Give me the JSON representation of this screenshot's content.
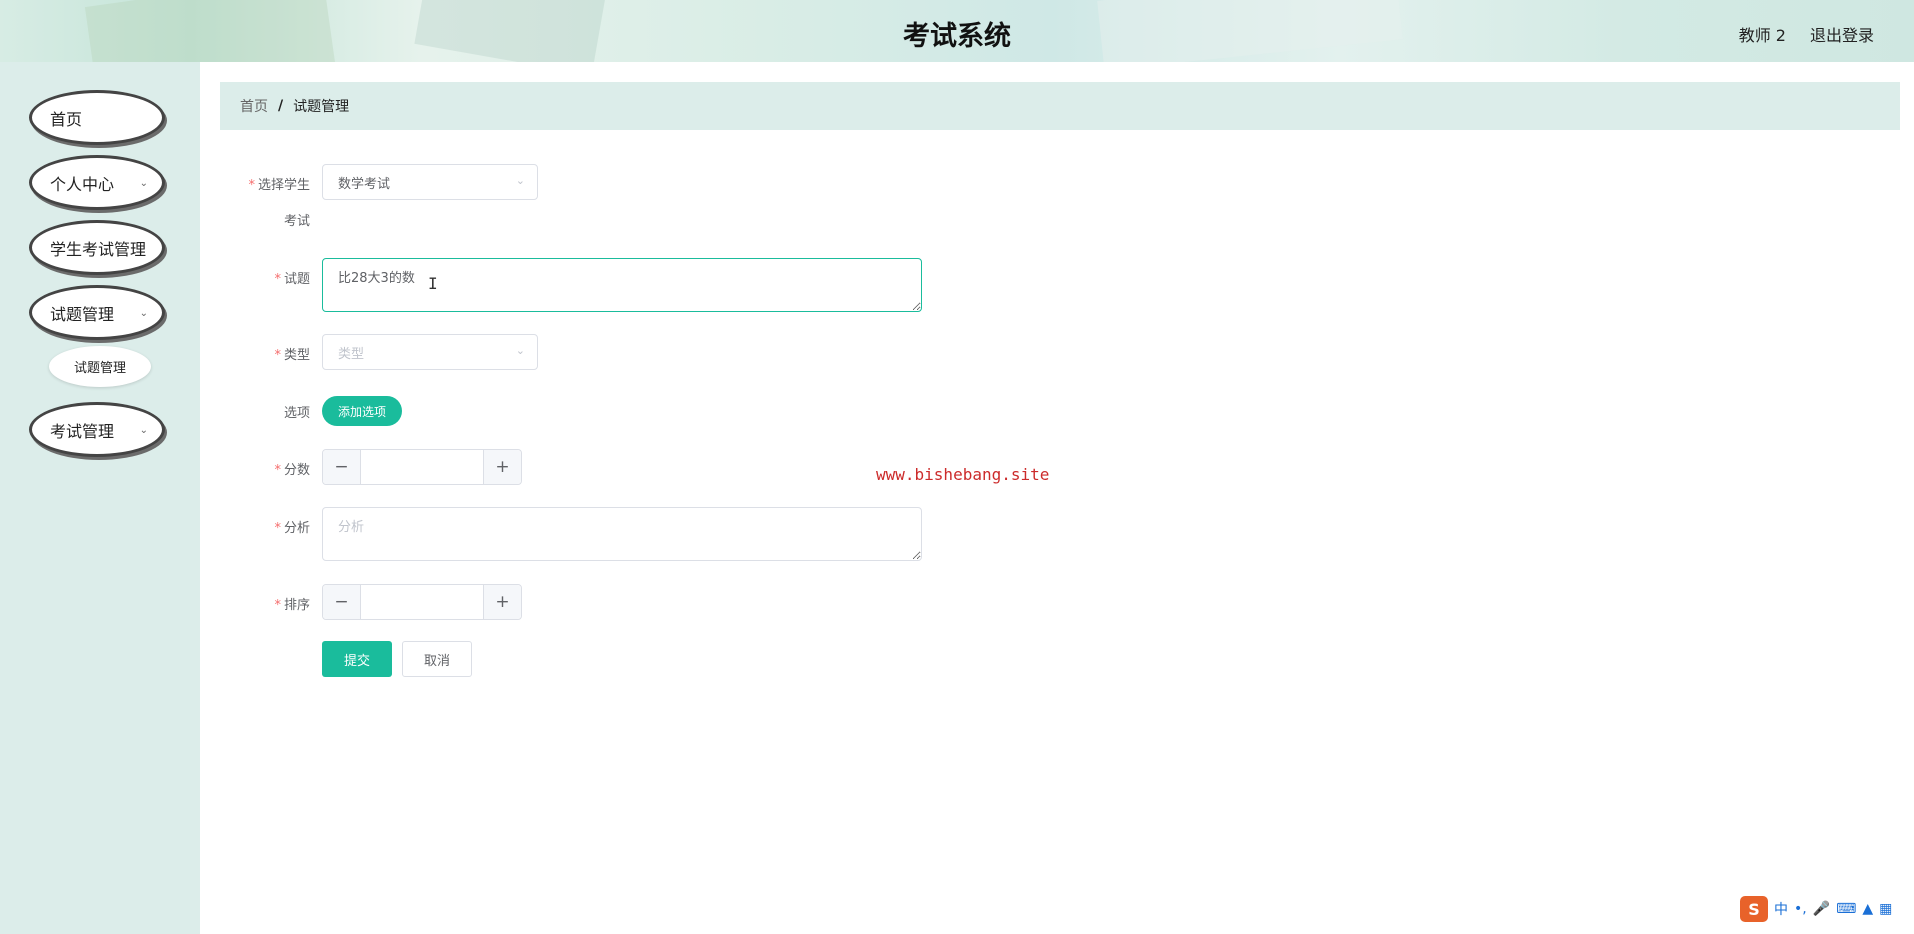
{
  "header": {
    "title": "考试系统",
    "user": "教师 2",
    "logout": "退出登录"
  },
  "sidebar": {
    "items": [
      {
        "label": "首页",
        "expandable": false
      },
      {
        "label": "个人中心",
        "expandable": true
      },
      {
        "label": "学生考试管理",
        "expandable": false
      },
      {
        "label": "试题管理",
        "expandable": true
      },
      {
        "label": "考试管理",
        "expandable": true
      }
    ],
    "submenu": {
      "label": "试题管理"
    }
  },
  "breadcrumb": {
    "home": "首页",
    "separator": "/",
    "current": "试题管理"
  },
  "form": {
    "exam": {
      "label_line1": "选择学生",
      "label_line2": "考试",
      "value": "数学考试"
    },
    "question": {
      "label": "试题",
      "value": "比28大3的数"
    },
    "type": {
      "label": "类型",
      "placeholder": "类型"
    },
    "options": {
      "label": "选项",
      "add_button": "添加选项"
    },
    "score": {
      "label": "分数",
      "minus": "−",
      "plus": "+",
      "value": ""
    },
    "analysis": {
      "label": "分析",
      "placeholder": "分析"
    },
    "sort": {
      "label": "排序",
      "minus": "−",
      "plus": "+",
      "value": ""
    },
    "submit": "提交",
    "cancel": "取消",
    "required_mark": "*"
  },
  "watermark": "www.bishebang.site",
  "ime": {
    "logo": "S",
    "mode": "中"
  },
  "colors": {
    "accent": "#1abc9c",
    "sidebar_bg": "#dcedea",
    "required": "#f56c6c"
  },
  "icons": {
    "chevron": "chevron-down-icon",
    "ibeam": "text-cursor-icon"
  }
}
